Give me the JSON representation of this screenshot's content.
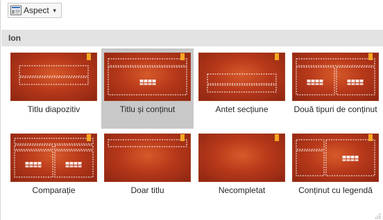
{
  "toolbar": {
    "aspect_label": "Aspect",
    "aspect_icon": "layout-icon"
  },
  "gallery": {
    "section_title": "Ion",
    "theme_colors": {
      "background": "#b8391a",
      "accent": "#f6a623",
      "placeholder": "#ffffff"
    },
    "layouts": [
      {
        "id": "title",
        "label": "Titlu diapozitiv",
        "selected": false
      },
      {
        "id": "title-content",
        "label": "Titlu și conținut",
        "selected": true
      },
      {
        "id": "section-header",
        "label": "Antet secțiune",
        "selected": false
      },
      {
        "id": "two-content",
        "label": "Două tipuri de conținut",
        "selected": false
      },
      {
        "id": "comparison",
        "label": "Comparație",
        "selected": false
      },
      {
        "id": "title-only",
        "label": "Doar titlu",
        "selected": false
      },
      {
        "id": "blank",
        "label": "Necompletat",
        "selected": false
      },
      {
        "id": "content-caption",
        "label": "Conținut cu legendă",
        "selected": false
      }
    ]
  }
}
